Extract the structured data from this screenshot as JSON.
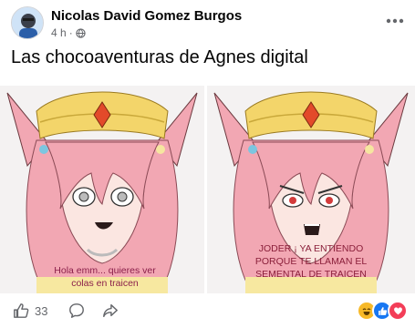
{
  "post": {
    "author": "Nicolas David Gomez Burgos",
    "time": "4 h",
    "separator": "·",
    "text": "Las chocoaventuras de Agnes digital"
  },
  "images": {
    "left_caption_line1": "Hola emm... quieres ver",
    "left_caption_line2": "colas en traicen",
    "right_caption_line1": "JODER ¡ YA ENTIENDO",
    "right_caption_line2": "PORQUE TE LLAMAN EL",
    "right_caption_line3": "SEMENTAL DE TRAICEN"
  },
  "actions": {
    "like_count": "33"
  },
  "icons": {
    "more": "more-dots-icon",
    "globe": "globe-icon",
    "like": "thumbs-up-icon",
    "comment": "comment-icon",
    "share": "share-icon"
  },
  "colors": {
    "like_blue": "#1877f2",
    "haha_yellow": "#f7b928",
    "love_red": "#f33e58",
    "hair_pink": "#f2a7b3",
    "hat_gold": "#f3d56a"
  }
}
